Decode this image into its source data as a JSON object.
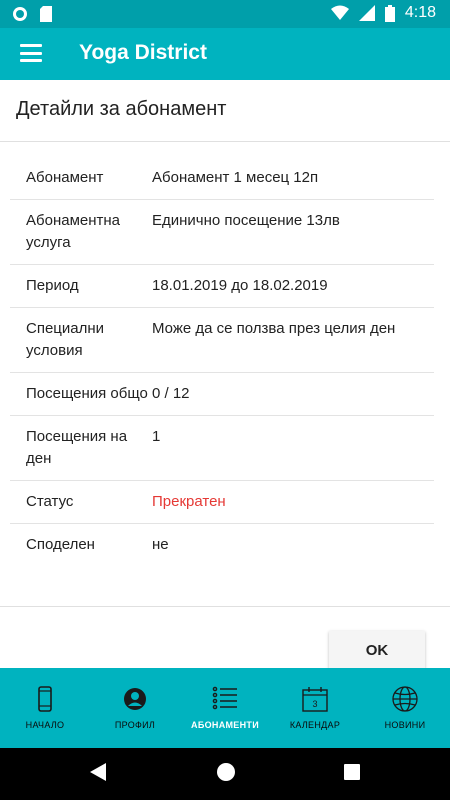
{
  "status_bar": {
    "time": "4:18"
  },
  "app_bar": {
    "title": "Yoga District"
  },
  "page": {
    "title": "Детайли за абонамент"
  },
  "details": [
    {
      "label": "Абонамент",
      "value": "Абонамент 1 месец 12п"
    },
    {
      "label": "Абонаментна услуга",
      "value": "Единично посещение 13лв"
    },
    {
      "label": "Период",
      "value": "18.01.2019 до 18.02.2019"
    },
    {
      "label": "Специални условия",
      "value": "Може да се ползва през целия ден"
    },
    {
      "label": "Посещения общо",
      "value": "0 / 12"
    },
    {
      "label": "Посещения на ден",
      "value": "1"
    },
    {
      "label": "Статус",
      "value": "Прекратен"
    },
    {
      "label": "Споделен",
      "value": "не"
    }
  ],
  "colors": {
    "accent": "#00b3bf",
    "status_bar": "#009faa",
    "status_danger": "#e53935"
  },
  "actions": {
    "ok_label": "OK"
  },
  "bottom_nav": [
    {
      "label": "НАЧАЛО",
      "icon": "phone-icon"
    },
    {
      "label": "ПРОФИЛ",
      "icon": "profile-icon"
    },
    {
      "label": "АБОНАМЕНТИ",
      "icon": "list-icon",
      "active": true
    },
    {
      "label": "КАЛЕНДАР",
      "icon": "calendar-icon"
    },
    {
      "label": "НОВИНИ",
      "icon": "globe-icon"
    }
  ]
}
